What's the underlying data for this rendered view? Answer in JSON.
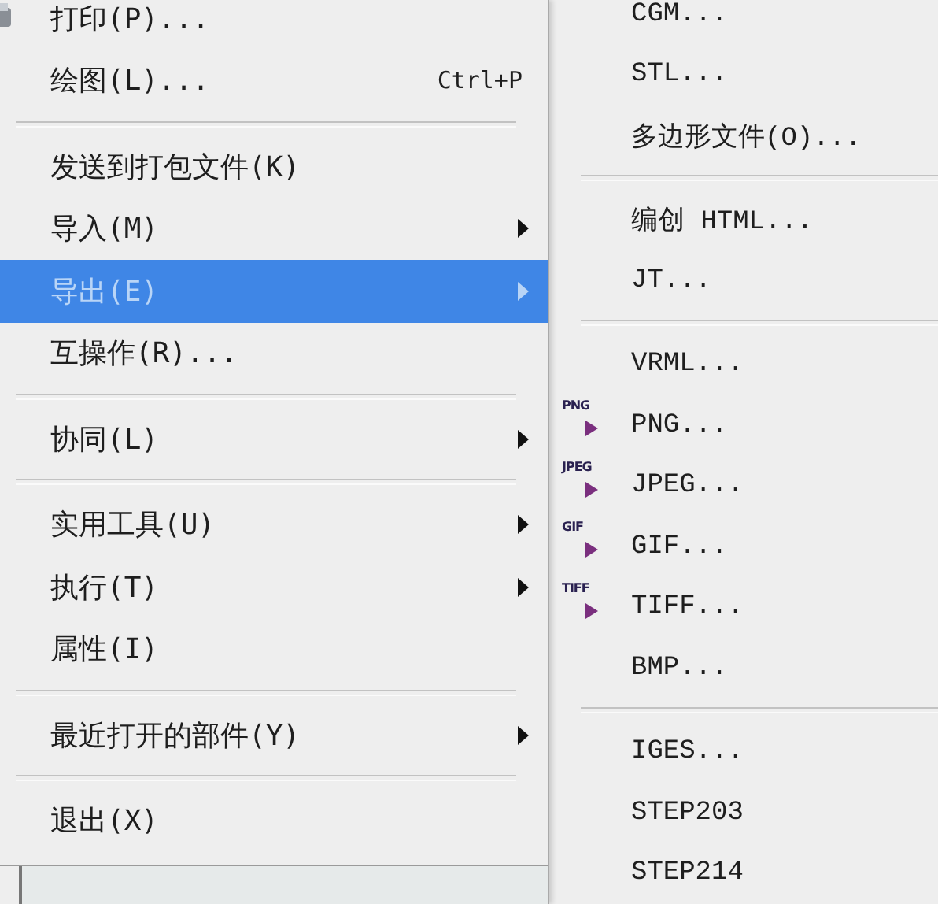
{
  "file_menu": {
    "items": [
      {
        "kind": "item",
        "label": "打印(P)...",
        "icon": true,
        "submenu": false,
        "selected": false
      },
      {
        "kind": "item",
        "label": "绘图(L)...",
        "shortcut": "Ctrl+P",
        "submenu": false,
        "selected": false
      },
      {
        "kind": "separator"
      },
      {
        "kind": "item",
        "label": "发送到打包文件(K)",
        "submenu": false,
        "selected": false
      },
      {
        "kind": "item",
        "label": "导入(M)",
        "submenu": true,
        "selected": false
      },
      {
        "kind": "item",
        "label": "导出(E)",
        "submenu": true,
        "selected": true
      },
      {
        "kind": "item",
        "label": "互操作(R)...",
        "submenu": false,
        "selected": false
      },
      {
        "kind": "separator"
      },
      {
        "kind": "item",
        "label": "协同(L)",
        "submenu": true,
        "selected": false
      },
      {
        "kind": "separator"
      },
      {
        "kind": "item",
        "label": "实用工具(U)",
        "submenu": true,
        "selected": false
      },
      {
        "kind": "item",
        "label": "执行(T)",
        "submenu": true,
        "selected": false
      },
      {
        "kind": "item",
        "label": "属性(I)",
        "submenu": false,
        "selected": false
      },
      {
        "kind": "separator"
      },
      {
        "kind": "item",
        "label": "最近打开的部件(Y)",
        "submenu": true,
        "selected": false
      },
      {
        "kind": "separator"
      },
      {
        "kind": "item",
        "label": "退出(X)",
        "submenu": false,
        "selected": false
      }
    ]
  },
  "export_submenu": {
    "items": [
      {
        "kind": "item",
        "label": "CGM..."
      },
      {
        "kind": "item",
        "label": "STL..."
      },
      {
        "kind": "item",
        "label": "多边形文件(O)..."
      },
      {
        "kind": "separator"
      },
      {
        "kind": "item",
        "label": "编创 HTML..."
      },
      {
        "kind": "item",
        "label": "JT..."
      },
      {
        "kind": "separator"
      },
      {
        "kind": "item",
        "label": "VRML..."
      },
      {
        "kind": "item",
        "label": "PNG...",
        "badge": "PNG"
      },
      {
        "kind": "item",
        "label": "JPEG...",
        "badge": "JPEG"
      },
      {
        "kind": "item",
        "label": "GIF...",
        "badge": "GIF"
      },
      {
        "kind": "item",
        "label": "TIFF...",
        "badge": "TIFF"
      },
      {
        "kind": "item",
        "label": "BMP..."
      },
      {
        "kind": "separator"
      },
      {
        "kind": "item",
        "label": "IGES..."
      },
      {
        "kind": "item",
        "label": "STEP203"
      },
      {
        "kind": "item",
        "label": "STEP214"
      }
    ]
  }
}
